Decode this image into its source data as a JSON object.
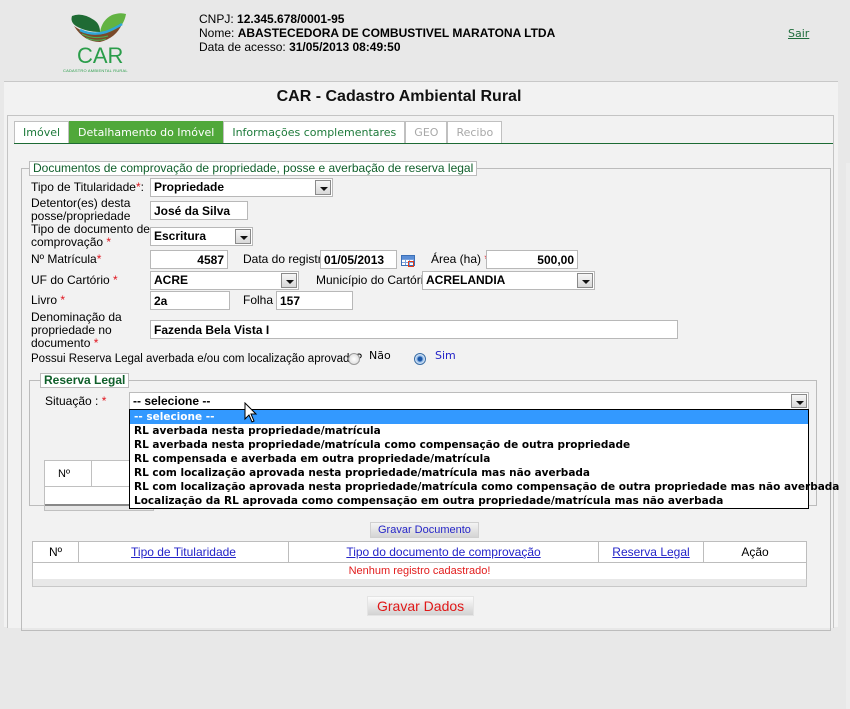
{
  "header": {
    "logo_text": "CAR",
    "logo_subtitle": "CADASTRO AMBIENTAL RURAL",
    "cnpj_label": "CNPJ:",
    "cnpj_value": "12.345.678/0001-95",
    "nome_label": "Nome:",
    "nome_value": "ABASTECEDORA DE COMBUSTIVEL MARATONA LTDA",
    "acesso_label": "Data de acesso:",
    "acesso_value": "31/05/2013 08:49:50",
    "logout_label": "Sair"
  },
  "page_title": "CAR - Cadastro Ambiental Rural",
  "tabs": [
    {
      "label": "Imóvel",
      "state": "normal"
    },
    {
      "label": "Detalhamento do Imóvel",
      "state": "active"
    },
    {
      "label": "Informações complementares",
      "state": "normal"
    },
    {
      "label": "GEO",
      "state": "disabled"
    },
    {
      "label": "Recibo",
      "state": "disabled"
    }
  ],
  "docs_section": {
    "legend": "Documentos de comprovação de propriedade, posse e averbação de reserva legal",
    "tipo_titularidade": {
      "label": "Tipo de Titularidade",
      "suffix": ":",
      "value": "Propriedade"
    },
    "detentores": {
      "label_line1": "Detentor(es) desta",
      "label_line2": "posse/propriedade",
      "value": "José da Silva"
    },
    "tipo_documento": {
      "label_line1": "Tipo de documento de",
      "label_line2": "comprovação",
      "value": "Escritura"
    },
    "matricula": {
      "label": "Nº Matrícula",
      "value": "4587"
    },
    "data_registro": {
      "label": "Data do registro",
      "value": "01/05/2013"
    },
    "area": {
      "label": "Área (ha)",
      "value": "500,00"
    },
    "uf_cartorio": {
      "label": "UF do Cartório",
      "value": "ACRE"
    },
    "municipio_cartorio": {
      "label": "Município do Cartório",
      "value": "ACRELANDIA"
    },
    "livro": {
      "label": "Livro",
      "value": "2a"
    },
    "folha": {
      "label": "Folha",
      "value": "157"
    },
    "denominacao": {
      "label_line1": "Denominação da",
      "label_line2": "propriedade no",
      "label_line3": "documento",
      "value": "Fazenda Bela Vista I"
    },
    "possui_rl": {
      "question": "Possui Reserva Legal averbada e/ou com localização aprovada?",
      "option_no": "Não",
      "option_yes": "Sim",
      "selected": "Sim"
    },
    "required_mark": "*"
  },
  "reserva_legal": {
    "legend": "Reserva Legal",
    "situacao_label": "Situação :",
    "situacao_value": "-- selecione --",
    "table_header_no": "Nº",
    "options": [
      "-- selecione --",
      "RL averbada nesta propriedade/matrícula",
      "RL averbada nesta propriedade/matrícula como compensação de outra propriedade",
      "RL compensada e averbada em outra propriedade/matrícula",
      "RL com localização aprovada nesta propriedade/matrícula mas não averbada",
      "RL com localização aprovada nesta propriedade/matrícula como compensação de outra propriedade mas não averbada",
      "Localização da RL aprovada como compensação em outra propriedade/matrícula mas não averbada"
    ],
    "highlighted_index": 0
  },
  "gravar_documento_label": "Gravar Documento",
  "grid": {
    "columns": [
      "Nº",
      "Tipo de Titularidade",
      "Tipo do documento de comprovação",
      "Reserva Legal",
      "Ação"
    ],
    "empty_message": "Nenhum registro cadastrado!"
  },
  "gravar_dados_label": "Gravar Dados"
}
